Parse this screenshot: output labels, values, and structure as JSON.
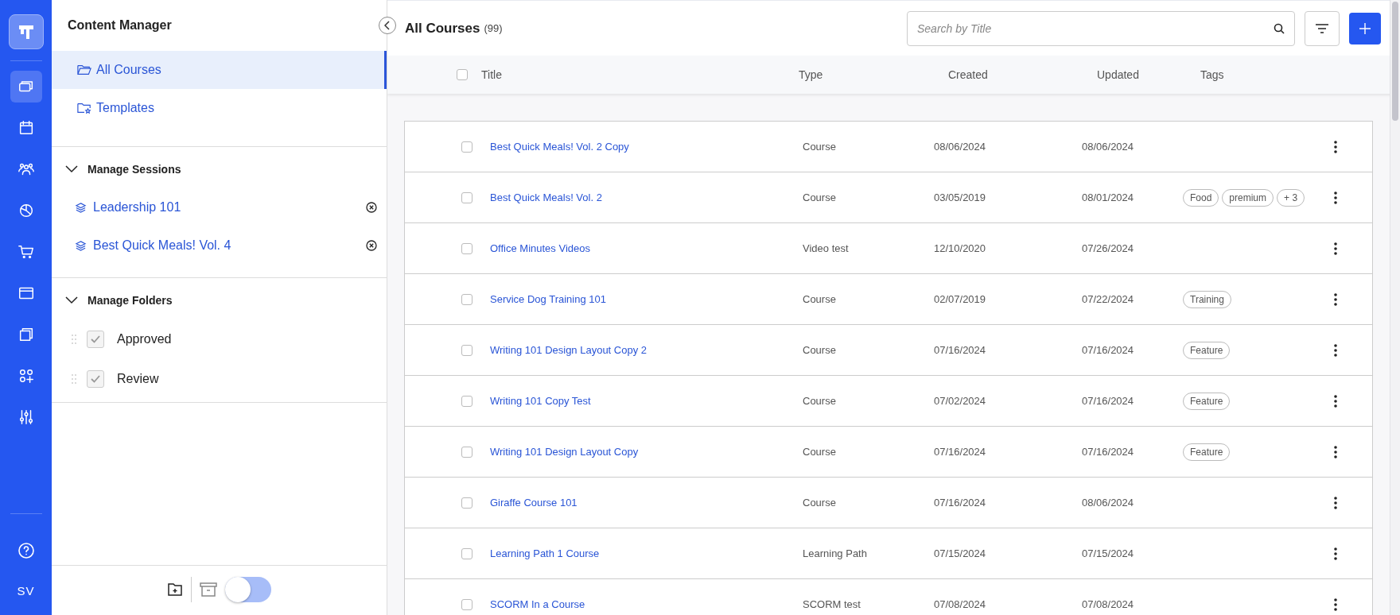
{
  "rail": {
    "items": [
      {
        "selected": true
      },
      {
        "selected": false
      },
      {
        "selected": false
      },
      {
        "selected": false
      },
      {
        "selected": false
      },
      {
        "selected": false
      },
      {
        "selected": false
      },
      {
        "selected": false
      },
      {
        "selected": false
      }
    ],
    "avatar": "SV"
  },
  "sidebar": {
    "title": "Content Manager",
    "nav": [
      {
        "label": "All Courses",
        "selected": true
      },
      {
        "label": "Templates",
        "selected": false
      }
    ],
    "sessions": {
      "title": "Manage Sessions",
      "expanded": true,
      "items": [
        "Leadership 101",
        "Best Quick Meals! Vol. 4"
      ]
    },
    "folders": {
      "title": "Manage Folders",
      "expanded": true,
      "items": [
        {
          "label": "Approved",
          "checked": true
        },
        {
          "label": "Review",
          "checked": true
        }
      ]
    },
    "archive_toggle": {
      "on": false
    }
  },
  "main": {
    "title": "All Courses",
    "count": "(99)",
    "search": {
      "placeholder": "Search by Title"
    },
    "select_all": {
      "checked": false
    },
    "columns": [
      "Title",
      "Type",
      "Created",
      "Updated",
      "Tags"
    ],
    "rows": [
      {
        "title": "Best Quick Meals! Vol. 2 Copy",
        "type": "Course",
        "created": "08/06/2024",
        "updated": "08/06/2024",
        "tags": [],
        "checked": false
      },
      {
        "title": "Best Quick Meals! Vol. 2",
        "type": "Course",
        "created": "03/05/2019",
        "updated": "08/01/2024",
        "tags": [
          "Food",
          "premium",
          "+ 3"
        ],
        "checked": false
      },
      {
        "title": "Office Minutes Videos",
        "type": "Video test",
        "created": "12/10/2020",
        "updated": "07/26/2024",
        "tags": [],
        "checked": false
      },
      {
        "title": "Service Dog Training 101",
        "type": "Course",
        "created": "02/07/2019",
        "updated": "07/22/2024",
        "tags": [
          "Training"
        ],
        "checked": false
      },
      {
        "title": "Writing 101 Design Layout Copy 2",
        "type": "Course",
        "created": "07/16/2024",
        "updated": "07/16/2024",
        "tags": [
          "Feature"
        ],
        "checked": false
      },
      {
        "title": "Writing 101 Copy Test",
        "type": "Course",
        "created": "07/02/2024",
        "updated": "07/16/2024",
        "tags": [
          "Feature"
        ],
        "checked": false
      },
      {
        "title": "Writing 101 Design Layout Copy",
        "type": "Course",
        "created": "07/16/2024",
        "updated": "07/16/2024",
        "tags": [
          "Feature"
        ],
        "checked": false
      },
      {
        "title": "Giraffe Course 101",
        "type": "Course",
        "created": "07/16/2024",
        "updated": "08/06/2024",
        "tags": [],
        "checked": false
      },
      {
        "title": "Learning Path 1 Course",
        "type": "Learning Path",
        "created": "07/15/2024",
        "updated": "07/15/2024",
        "tags": [],
        "checked": false
      },
      {
        "title": "SCORM In a Course",
        "type": "SCORM test",
        "created": "07/08/2024",
        "updated": "07/08/2024",
        "tags": [],
        "checked": false
      }
    ]
  }
}
